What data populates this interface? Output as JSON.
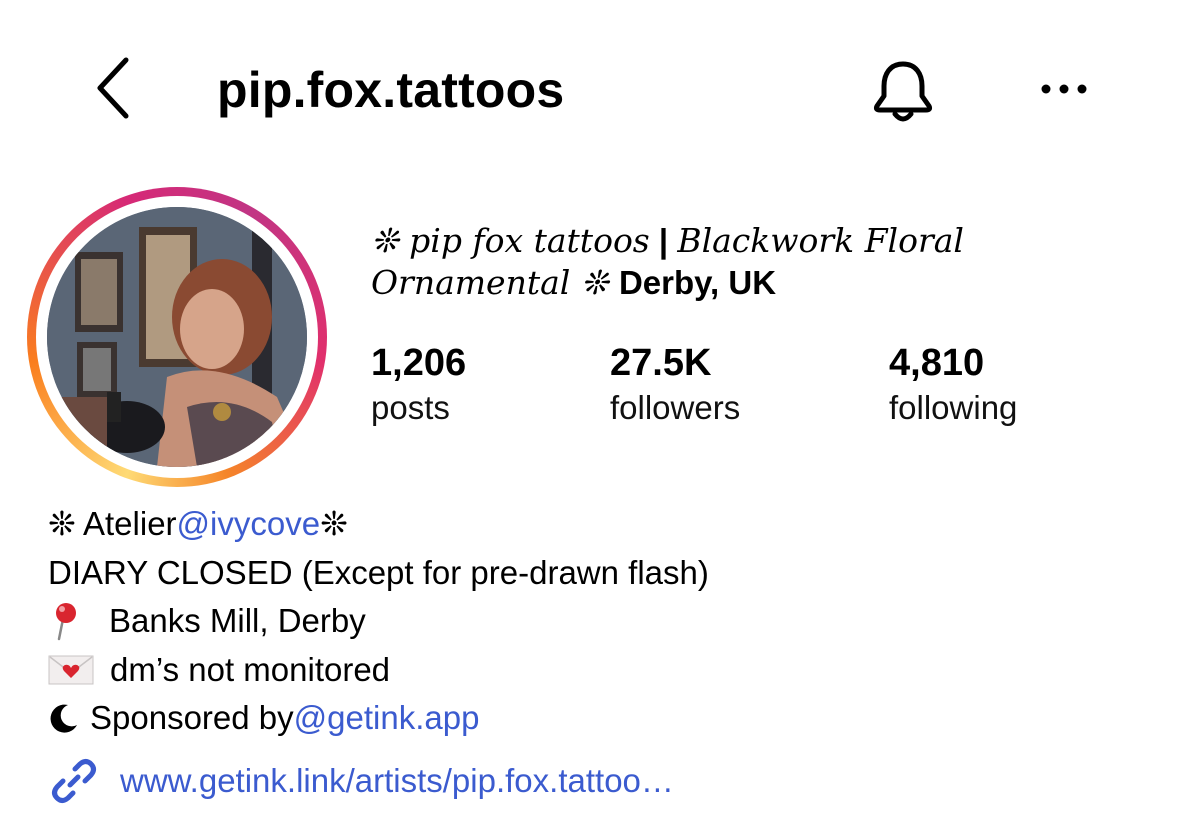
{
  "header": {
    "username": "pip.fox.tattoos",
    "back_icon": "chevron-left-icon",
    "bell_icon": "bell-icon",
    "more_icon": "more-horizontal-icon"
  },
  "profile": {
    "name_part1": "❊ pip fox tattoos",
    "name_sep": " | ",
    "name_part2": "Blackwork Floral",
    "name_part3": "Ornamental ❊ ",
    "name_location": "Derby, UK"
  },
  "stats": {
    "posts_count": "1,206",
    "posts_label": "posts",
    "followers_count": "27.5K",
    "followers_label": "followers",
    "following_count": "4,810",
    "following_label": "following"
  },
  "bio": {
    "line1_prefix": "❊ Atelier ",
    "line1_mention": "@ivycove",
    "line1_suffix": " ❊",
    "line2": "DIARY CLOSED (Except for pre-drawn flash)",
    "line3": "Banks Mill, Derby",
    "line4": "dm’s not monitored",
    "line5_prefix": "Sponsored by ",
    "line5_mention": "@getink.app",
    "link": "www.getink.link/artists/pip.fox.tattoo…"
  },
  "colors": {
    "link": "#3b5bcf",
    "ring_start": "#feda75",
    "ring_end": "#c13584"
  }
}
